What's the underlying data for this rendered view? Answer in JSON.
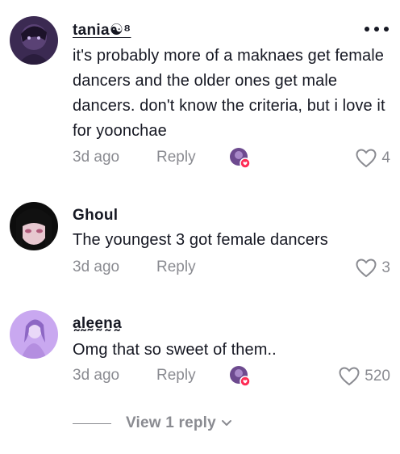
{
  "comments": [
    {
      "username": "tania☯⁸",
      "text": "it's probably more of a maknaes get female dancers and the older ones get male dancers. don't know the criteria, but i love it for yoonchae",
      "time": "3d ago",
      "reply_label": "Reply",
      "likes": "4",
      "avatar_icon": "user-avatar-dark-purple",
      "creator_liked": true
    },
    {
      "username": "Ghoul",
      "text": "The youngest 3 got female dancers",
      "time": "3d ago",
      "reply_label": "Reply",
      "likes": "3",
      "avatar_icon": "user-avatar-anime-face",
      "creator_liked": false
    },
    {
      "username": "a̰l̰ḛḛn̰a̰",
      "text": "Omg that so sweet of them..",
      "time": "3d ago",
      "reply_label": "Reply",
      "likes": "520",
      "avatar_icon": "user-avatar-purple-portrait",
      "creator_liked": true
    }
  ],
  "view_replies_label": "View 1 reply",
  "colors": {
    "text": "#161823",
    "muted": "#8a8b91",
    "badge": "#fe2c55"
  }
}
